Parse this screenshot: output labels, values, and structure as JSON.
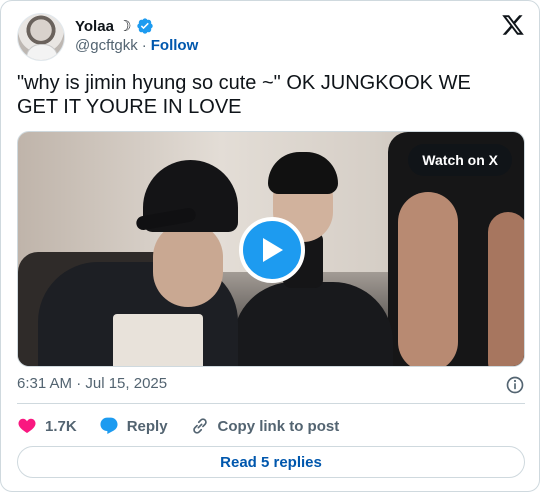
{
  "author": {
    "name": "Yolaa ☽",
    "handle": "@gcftgkk",
    "separator": "·",
    "follow_label": "Follow"
  },
  "tweet": {
    "text": "\"why is jimin hyung so cute ~\" OK JUNGKOOK WE GET IT YOURE IN LOVE",
    "timestamp": "6:31 AM · Jul 15, 2025"
  },
  "media": {
    "watch_label": "Watch on X"
  },
  "actions": {
    "like_count": "1.7K",
    "reply_label": "Reply",
    "copy_link_label": "Copy link to post"
  },
  "footer": {
    "read_replies_label": "Read 5 replies"
  },
  "colors": {
    "accent": "#1d9bf0",
    "link": "#0057ad",
    "like": "#f91880",
    "muted": "#536471"
  },
  "icons": [
    "verified-badge-icon",
    "x-logo-icon",
    "play-icon",
    "info-icon",
    "heart-icon",
    "reply-bubble-icon",
    "link-icon"
  ]
}
